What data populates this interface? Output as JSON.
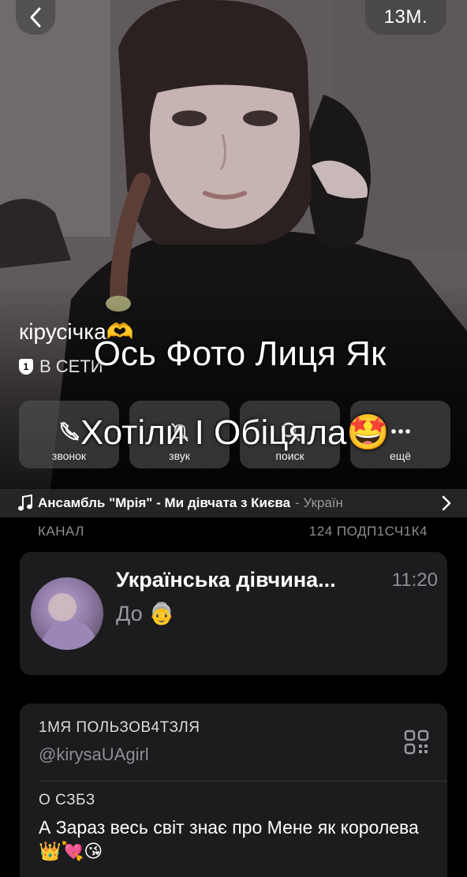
{
  "header": {
    "back_icon": "chevron-left-icon",
    "time_badge": "13М."
  },
  "profile": {
    "name": "кірусічка🫶",
    "status_badge": "1",
    "status": "В СЕТИ"
  },
  "overlay": {
    "line1": "Ось Фото Лиця Як",
    "line2": "Хотіли І Обіцяла🤩"
  },
  "actions": [
    {
      "label": "звонок",
      "icon": "phone-icon"
    },
    {
      "label": "звук",
      "icon": "bell-muted-icon"
    },
    {
      "label": "поиск",
      "icon": "search-icon"
    },
    {
      "label": "ещё",
      "icon": "more-icon"
    }
  ],
  "music": {
    "title": "Ансамбль \"Мрія\" - Ми дівчата з Києва",
    "genre": "- Україн",
    "icon": "music-note-icon"
  },
  "channel": {
    "section_label": "КАНАЛ",
    "subscribers": "124 ПОДП1СЧ1К4",
    "name": "Українська дівчина...",
    "time": "11:20",
    "last_message": "До 👵"
  },
  "info": {
    "username_label": "1МЯ ПОЛЬЗОВ4ТЗЛЯ",
    "username": "@kirysaUAgirl",
    "bio_label": "О СЗБЗ",
    "bio": "А Зараз весь світ знає про Мене як королева 👑💘😘",
    "qr_icon": "qr-code-icon"
  },
  "colors": {
    "background": "#000000",
    "card": "#1c1c1e",
    "secondary_text": "#8e8e93"
  }
}
